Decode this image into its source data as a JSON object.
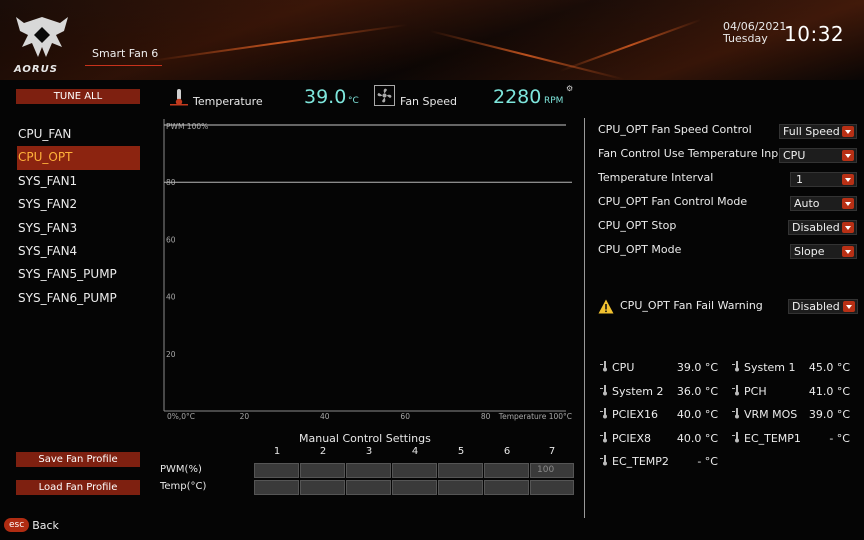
{
  "header": {
    "brand": "AORUS",
    "tab": "Smart Fan 6",
    "date": "04/06/2021",
    "day": "Tuesday",
    "time": "10:32"
  },
  "left_panel": {
    "tune_all": "TUNE ALL",
    "fans": [
      "CPU_FAN",
      "CPU_OPT",
      "SYS_FAN1",
      "SYS_FAN2",
      "SYS_FAN3",
      "SYS_FAN4",
      "SYS_FAN5_PUMP",
      "SYS_FAN6_PUMP"
    ],
    "selected_fan": "CPU_OPT",
    "save_profile": "Save Fan Profile",
    "load_profile": "Load Fan Profile"
  },
  "footer": {
    "esc_key": "esc",
    "back": "Back"
  },
  "readout": {
    "temperature_label": "Temperature",
    "temperature_value": "39.0",
    "temperature_unit": "°C",
    "fan_speed_label": "Fan Speed",
    "fan_speed_value": "2280",
    "fan_speed_unit": "RPM"
  },
  "chart_data": {
    "type": "line",
    "ylabel": "PWM 100%",
    "xlabel": "Temperature 100°C",
    "origin_label": "0%,0°C",
    "x_ticks": [
      "20",
      "40",
      "60",
      "80"
    ],
    "y_ticks": [
      "80",
      "60",
      "40",
      "20"
    ],
    "xlim": [
      0,
      100
    ],
    "ylim": [
      0,
      100
    ],
    "grid": false,
    "series": [
      {
        "x": [
          0,
          100
        ],
        "y": [
          100,
          100
        ]
      }
    ],
    "guide_line_y": 80
  },
  "manual": {
    "title": "Manual Control Settings",
    "columns": [
      "1",
      "2",
      "3",
      "4",
      "5",
      "6",
      "7"
    ],
    "rows": [
      {
        "label": "PWM(%)",
        "values": [
          "",
          "",
          "",
          "",
          "",
          "",
          "100"
        ]
      },
      {
        "label": "Temp(°C)",
        "values": [
          "",
          "",
          "",
          "",
          "",
          "",
          ""
        ]
      }
    ]
  },
  "settings": [
    {
      "label": "CPU_OPT Fan Speed Control",
      "value": "Full Speed"
    },
    {
      "label": "Fan Control Use Temperature Input",
      "value": "CPU"
    },
    {
      "label": "Temperature Interval",
      "value": "1"
    },
    {
      "label": "CPU_OPT Fan Control Mode",
      "value": "Auto"
    },
    {
      "label": "CPU_OPT Stop",
      "value": "Disabled"
    },
    {
      "label": "CPU_OPT Mode",
      "value": "Slope"
    }
  ],
  "warning": {
    "label": "CPU_OPT Fan Fail Warning",
    "value": "Disabled"
  },
  "sensors": [
    {
      "name": "CPU",
      "value": "39.0 °C"
    },
    {
      "name": "System 1",
      "value": "45.0 °C"
    },
    {
      "name": "System 2",
      "value": "36.0 °C"
    },
    {
      "name": "PCH",
      "value": "41.0 °C"
    },
    {
      "name": "PCIEX16",
      "value": "40.0 °C"
    },
    {
      "name": "VRM MOS",
      "value": "39.0 °C"
    },
    {
      "name": "PCIEX8",
      "value": "40.0 °C"
    },
    {
      "name": "EC_TEMP1",
      "value": "- °C"
    },
    {
      "name": "EC_TEMP2",
      "value": "- °C"
    }
  ],
  "colors": {
    "accent": "#8c2410",
    "value_cyan": "#7ee6dc",
    "selected_text": "#ffb13a"
  }
}
